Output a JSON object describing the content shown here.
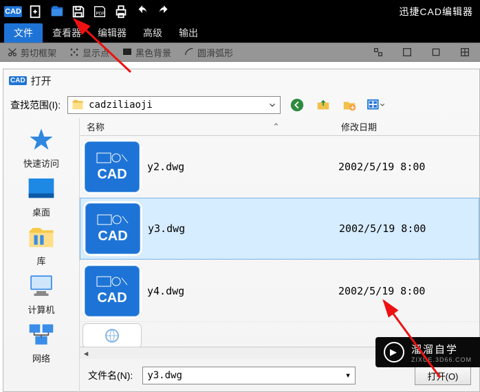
{
  "app": {
    "title_right": "迅捷CAD编辑器",
    "logo": "CAD"
  },
  "menubar": {
    "file": "文件",
    "view": "查看器",
    "editor": "编辑器",
    "advanced": "高级",
    "output": "输出"
  },
  "toolstrip": {
    "cut_frame": "剪切框架",
    "show_points": "显示点",
    "black_bg": "黑色背景",
    "smooth_arc": "圆滑弧形"
  },
  "dialog": {
    "title": "打开",
    "lookin_label": "查找范围(I):",
    "folder_name": "cadziliaoji",
    "col_name": "名称",
    "col_date": "修改日期",
    "filename_label": "文件名(N):",
    "filename_value": "y3.dwg",
    "open_button": "打开(O)"
  },
  "files": [
    {
      "name": "y2.dwg",
      "date": "2002/5/19 8:00"
    },
    {
      "name": "y3.dwg",
      "date": "2002/5/19 8:00"
    },
    {
      "name": "y4.dwg",
      "date": "2002/5/19 8:00"
    }
  ],
  "places": {
    "quick": "快速访问",
    "desktop": "桌面",
    "libs": "库",
    "computer": "计算机",
    "network": "网络"
  },
  "watermark": {
    "main": "溜溜自学",
    "sub": "ZIXUE.3D66.COM"
  }
}
